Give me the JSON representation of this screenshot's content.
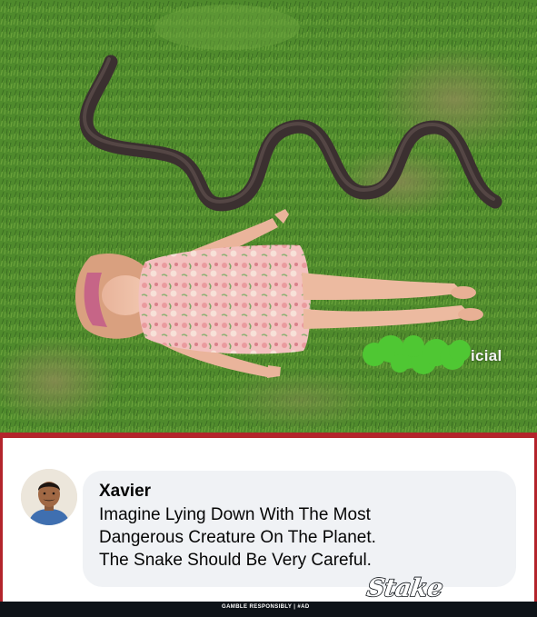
{
  "photo": {
    "watermark": "icial"
  },
  "comment": {
    "author": "Xavier",
    "lines": [
      "Imagine Lying Down With The Most",
      "Dangerous Creature On The Planet.",
      "The Snake Should Be Very Careful."
    ]
  },
  "footer": {
    "disclaimer": "GAMBLE RESPONSIBLY  |  #AD",
    "brand": "Stake"
  },
  "colors": {
    "grass": "#4f8a2c",
    "snake": "#3c3232",
    "frame_red": "#b3242b",
    "bubble_bg": "#f0f2f5",
    "footer_bg": "#0e1318",
    "blob_green": "#4fc733"
  }
}
